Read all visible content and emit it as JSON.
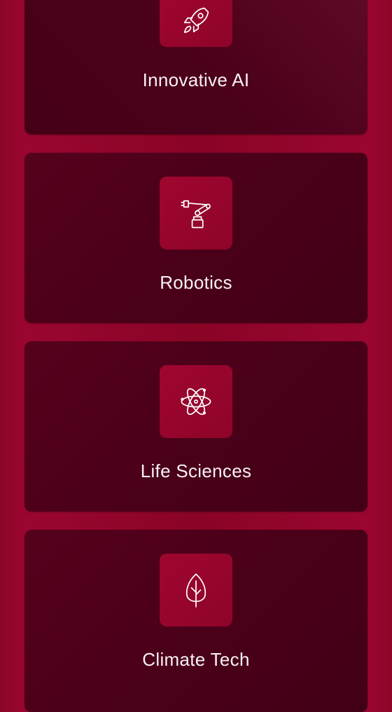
{
  "cards": [
    {
      "label": "Innovative AI",
      "icon": "rocket-icon"
    },
    {
      "label": "Robotics",
      "icon": "robotic-arm-icon"
    },
    {
      "label": "Life Sciences",
      "icon": "atom-icon"
    },
    {
      "label": "Climate Tech",
      "icon": "leaf-icon"
    }
  ],
  "colors": {
    "background": "#8c0527",
    "card": "#4a0019",
    "icon_tile": "#9a0630",
    "text": "#f7f1f3"
  }
}
